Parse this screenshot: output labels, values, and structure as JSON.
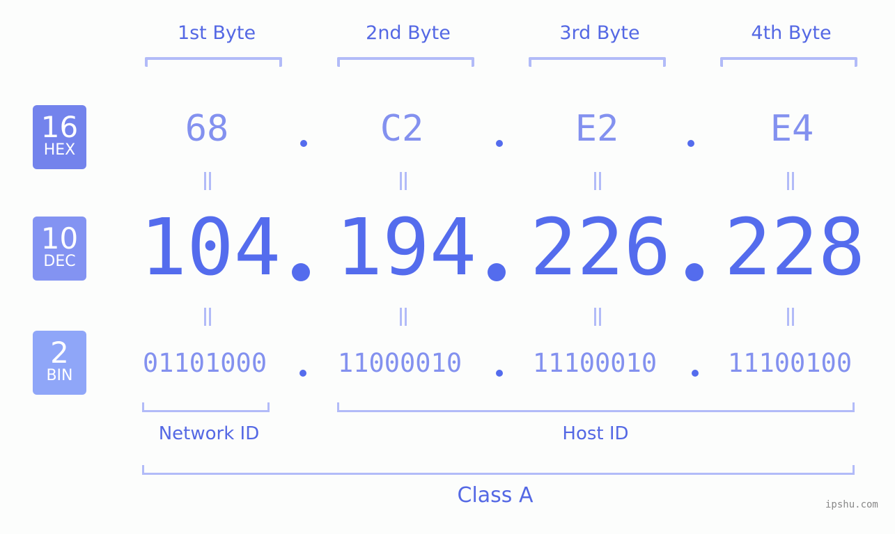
{
  "bytes": [
    {
      "label": "1st Byte",
      "hex": "68",
      "dec": "104",
      "bin": "01101000"
    },
    {
      "label": "2nd Byte",
      "hex": "C2",
      "dec": "194",
      "bin": "11000010"
    },
    {
      "label": "3rd Byte",
      "hex": "E2",
      "dec": "226",
      "bin": "11100010"
    },
    {
      "label": "4th Byte",
      "hex": "E4",
      "dec": "228",
      "bin": "11100100"
    }
  ],
  "badges": {
    "hex": {
      "num": "16",
      "sub": "HEX",
      "color": "#7383ec"
    },
    "dec": {
      "num": "10",
      "sub": "DEC",
      "color": "#8393f2"
    },
    "bin": {
      "num": "2",
      "sub": "BIN",
      "color": "#8fa6f8"
    }
  },
  "parts": {
    "network": "Network ID",
    "host": "Host ID",
    "class": "Class A"
  },
  "watermark": "ipshu.com",
  "colors": {
    "accent": "#546ced",
    "light": "#b2bbf8",
    "mid": "#8391ef"
  }
}
